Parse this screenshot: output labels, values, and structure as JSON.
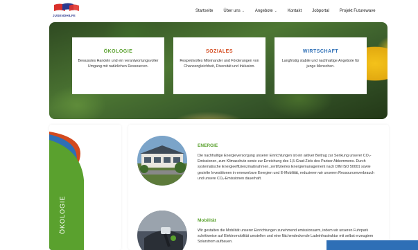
{
  "nav": {
    "logo_text": "JUGENDHILFE",
    "items": [
      {
        "label": "Startseite"
      },
      {
        "label": "Über uns",
        "has_dropdown": true
      },
      {
        "label": "Angebote",
        "has_dropdown": true
      },
      {
        "label": "Kontakt"
      },
      {
        "label": "Jobportal"
      },
      {
        "label": "Projekt Futurewave"
      }
    ]
  },
  "hero": {
    "cards": [
      {
        "title": "ÖKOLOGIE",
        "text": "Bewusstes Handeln und ein verantwortungsvoller Umgang mit natürlichen Ressourcen.",
        "color": "#5aa12e"
      },
      {
        "title": "SOZIALES",
        "text": "Respektvolles Miteinander und Förderungen von Chancengleichheit, Diversität und Inklusion.",
        "color": "#d34a1e"
      },
      {
        "title": "WIRTSCHAFT",
        "text": "Langfristig stabile und nachhaltige Angebote für junge Menschen.",
        "color": "#2e6fb6"
      }
    ]
  },
  "side": {
    "label": "ÖKOLOGIE"
  },
  "content": {
    "items": [
      {
        "title": "ENERGIE",
        "text": "Die nachhaltige Energieversorgung unserer Einrichtungen ist ein aktiver Beitrag zur Senkung unserer CO₂-Emissionen, zum Klimaschutz sowie zur Erreichung des 1,5-Grad-Ziels des Pariser Abkommens. Durch systematische Energieeffizienzmaßnahmen, zertifiziertes Energiemanagement nach DIN ISO 50001 sowie gezielte Investitionen in erneuerbare Energien und E-Mobilität, reduzieren wir unseren Ressourcenverbrauch und unsere CO₂-Emissionen dauerhaft."
      },
      {
        "title": "Mobilität",
        "text": "Wir gestalten die Mobilität unserer Einrichtungen zunehmend emissionsarm, indem wir unseren Fuhrpark schrittweise auf Elektromobilität umstellen und eine flächendeckende Ladeinfrastruktur mit selbst erzeugtem Solarstrom aufbauen."
      }
    ]
  },
  "colors": {
    "green": "#5aa12e",
    "orange": "#d34a1e",
    "blue": "#2e6fb6",
    "navy": "#2b3a8f"
  }
}
